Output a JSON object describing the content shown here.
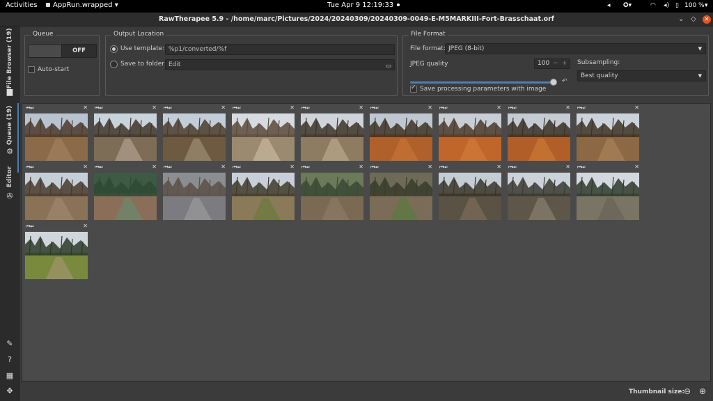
{
  "topbar": {
    "activities": "Activities",
    "app_menu": "AppRun.wrapped",
    "clock": "Tue Apr 9  12:19:33",
    "battery": "100 %"
  },
  "window": {
    "title": "RawTherapee 5.9 - /home/marc/Pictures/2024/20240309/20240309-0049-E-M5MARKIII-Fort-Brasschaat.orf"
  },
  "sidebar": {
    "tabs": [
      {
        "label": "File Browser (19)",
        "icon": "folder-icon"
      },
      {
        "label": "Queue (19)",
        "icon": "gears-icon"
      },
      {
        "label": "Editor",
        "icon": "aperture-icon"
      }
    ]
  },
  "queue": {
    "title": "Queue",
    "toggle_state": "OFF",
    "autostart_label": "Auto-start",
    "autostart_checked": false
  },
  "output_location": {
    "title": "Output Location",
    "use_template_label": "Use template:",
    "template_value": "%p1/converted/%f",
    "save_to_folder_label": "Save to folder:",
    "folder_value": "Edit",
    "selected": "template"
  },
  "file_format": {
    "title": "File Format",
    "format_label": "File format:",
    "format_value": "JPEG (8-bit)",
    "jpeg_quality_label": "JPEG quality",
    "jpeg_quality_value": "100",
    "jpeg_quality_fraction": 1.0,
    "subsampling_label": "Subsampling:",
    "subsampling_value": "Best quality",
    "save_params_label": "Save processing parameters with image",
    "save_params_checked": true
  },
  "thumbnails": {
    "count": 19,
    "items": [
      {
        "sky": "#b8c3cf",
        "ground": "#8a6a48",
        "trees": "#4b3a2c",
        "accent": "#a08060"
      },
      {
        "sky": "#c9d3dc",
        "ground": "#7d6c56",
        "trees": "#3e3528",
        "accent": "#b0a090"
      },
      {
        "sky": "#c3cdd8",
        "ground": "#6e5a40",
        "trees": "#4a3c2c",
        "accent": "#9c8c74"
      },
      {
        "sky": "#d6dbe2",
        "ground": "#9b8a70",
        "trees": "#5a4a38",
        "accent": "#c8b89c"
      },
      {
        "sky": "#d0d4da",
        "ground": "#8e7c62",
        "trees": "#3c3428",
        "accent": "#b8a88c"
      },
      {
        "sky": "#bfc8d2",
        "ground": "#b0602a",
        "trees": "#3e3426",
        "accent": "#c87438"
      },
      {
        "sky": "#c8ced4",
        "ground": "#c0662a",
        "trees": "#4a3a2a",
        "accent": "#d07a3a"
      },
      {
        "sky": "#c4cbd3",
        "ground": "#b25e28",
        "trees": "#3a3024",
        "accent": "#cc7838"
      },
      {
        "sky": "#cbd2da",
        "ground": "#8c6844",
        "trees": "#3e3224",
        "accent": "#a8825a"
      },
      {
        "sky": "#c6ced8",
        "ground": "#8a7256",
        "trees": "#463a2c",
        "accent": "#a08870"
      },
      {
        "sky": "#3e5a44",
        "ground": "#8a6e58",
        "trees": "#2e4a34",
        "accent": "#6a8a6c"
      },
      {
        "sky": "#8a8e90",
        "ground": "#7c7c80",
        "trees": "#5a5048",
        "accent": "#9a9a9c"
      },
      {
        "sky": "#c8cfd8",
        "ground": "#8a7a58",
        "trees": "#3e3a2a",
        "accent": "#6a7a3a"
      },
      {
        "sky": "#6a7a5a",
        "ground": "#7a6a54",
        "trees": "#3a4a34",
        "accent": "#8c7c64"
      },
      {
        "sky": "#6e6a58",
        "ground": "#7a6c56",
        "trees": "#3a3c2c",
        "accent": "#5a7a40"
      },
      {
        "sky": "#c4ccd4",
        "ground": "#5a5244",
        "trees": "#3a3428",
        "accent": "#7a6c58"
      },
      {
        "sky": "#ccd2da",
        "ground": "#5e5648",
        "trees": "#3a3a30",
        "accent": "#8a8070"
      },
      {
        "sky": "#d4d8de",
        "ground": "#7a7464",
        "trees": "#2e3a2c",
        "accent": "#6a6458"
      },
      {
        "sky": "#cfd6dc",
        "ground": "#7a8a3c",
        "trees": "#2c3a28",
        "accent": "#a0946c"
      }
    ]
  },
  "statusbar": {
    "thumbnail_size_label": "Thumbnail size:"
  }
}
